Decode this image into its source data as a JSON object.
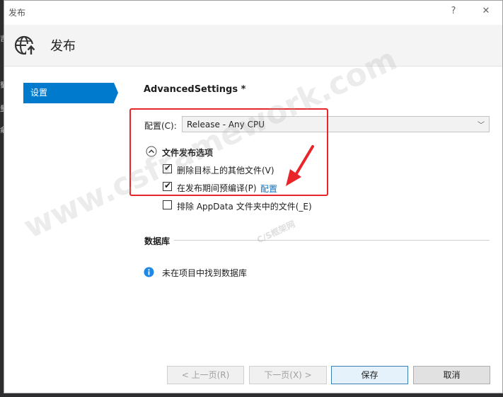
{
  "window": {
    "title": "发布",
    "help": "?",
    "close": "✕"
  },
  "header": {
    "title": "发布",
    "icon": "globe-upload-icon"
  },
  "nav": {
    "items": [
      {
        "label": "设置",
        "selected": true
      }
    ]
  },
  "main": {
    "section_title": "AdvancedSettings *",
    "config": {
      "label": "配置(C):",
      "value": "Release - Any CPU"
    },
    "file_publish": {
      "title": "文件发布选项",
      "options": [
        {
          "label": "删除目标上的其他文件(V)",
          "checked": true
        },
        {
          "label": "在发布期间预编译(P)",
          "checked": true,
          "link": "配置"
        },
        {
          "label": "排除 AppData 文件夹中的文件(_E)",
          "checked": false
        }
      ]
    },
    "database": {
      "title": "数据库",
      "info": "未在项目中找到数据库"
    }
  },
  "footer": {
    "prev": "< 上一页(R)",
    "next": "下一页(X) >",
    "save": "保存",
    "cancel": "取消"
  },
  "watermark": {
    "main": "www.csframework.com",
    "sub": "C/S框架网"
  },
  "colors": {
    "accent": "#007acc",
    "highlight_box": "#e8262a",
    "link": "#0e70c0"
  }
}
